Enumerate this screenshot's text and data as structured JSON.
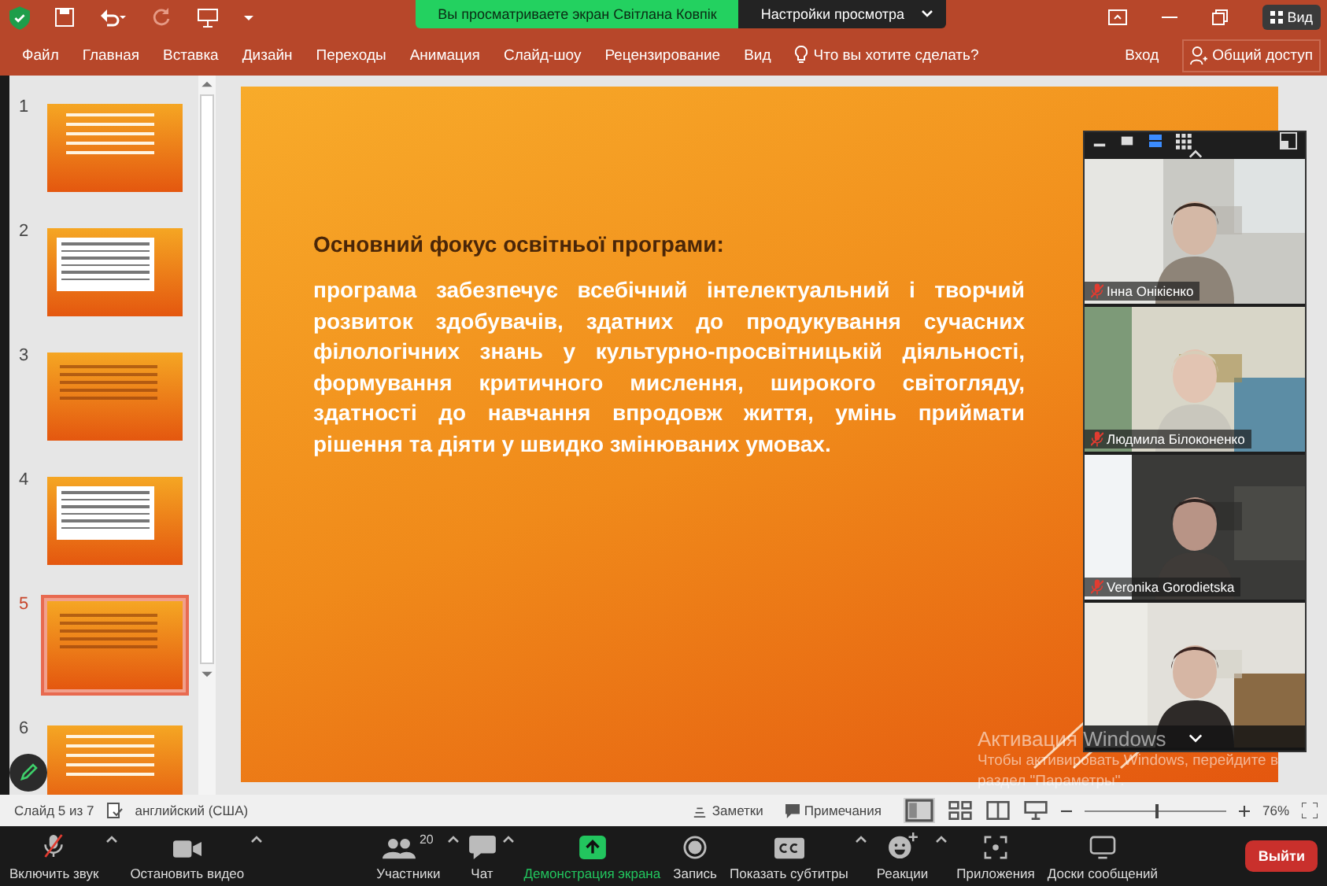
{
  "title_bar": {
    "banner": "Вы просматриваете экран Світлана Ковпік",
    "view_settings": "Настройки просмотра",
    "view_button": "Вид"
  },
  "ribbon": {
    "tabs": [
      "Файл",
      "Главная",
      "Вставка",
      "Дизайн",
      "Переходы",
      "Анимация",
      "Слайд-шоу",
      "Рецензирование",
      "Вид"
    ],
    "search": {
      "placeholder": "Что вы хотите сделать?"
    },
    "sign_in": "Вход",
    "share": "Общий доступ"
  },
  "slides_panel": {
    "slides": [
      {
        "number": "1",
        "selected": false,
        "kind": "title"
      },
      {
        "number": "2",
        "selected": false,
        "kind": "boxed"
      },
      {
        "number": "3",
        "selected": false,
        "kind": "text"
      },
      {
        "number": "4",
        "selected": false,
        "kind": "boxed"
      },
      {
        "number": "5",
        "selected": true,
        "kind": "text"
      },
      {
        "number": "6",
        "selected": false,
        "kind": "title"
      }
    ]
  },
  "slide": {
    "heading": "Основний фокус освітньої програми:",
    "body": "програма забезпечує всебічний інтелектуальний і творчий розвиток здобувачів, здатних до продукування сучасних філологічних знань у культурно-просвітницькій діяльності, формування критичного мислення, широкого світогляду, здатності до навчання впродовж життя, умінь приймати рішення та діяти у швидко змінюваних умовах."
  },
  "video_panel": {
    "participants": [
      {
        "name": "Інна Онікієнко",
        "muted": true
      },
      {
        "name": "Людмила Білоконенко",
        "muted": true
      },
      {
        "name": "Veronika Gorodietska",
        "muted": true
      },
      {
        "muted": false
      }
    ]
  },
  "status_bar": {
    "slide_counter": "Слайд 5 из 7",
    "language": "английский (США)",
    "notes": "Заметки",
    "comments": "Примечания",
    "zoom": "76%",
    "zoom_slider": {
      "level": 0.5
    }
  },
  "meeting_toolbar": {
    "buttons": [
      {
        "kind": "mic",
        "label": "Включить звук",
        "caret": true,
        "active": false,
        "muted": true
      },
      {
        "kind": "video",
        "label": "Остановить видео",
        "caret": true,
        "active": false
      },
      {
        "kind": "participants",
        "label": "Участники",
        "count": "20",
        "caret": true,
        "active": false
      },
      {
        "kind": "chat",
        "label": "Чат",
        "caret": true,
        "active": false
      },
      {
        "kind": "share",
        "label": "Демонстрация экрана",
        "caret": false,
        "active": true
      },
      {
        "kind": "record",
        "label": "Запись",
        "caret": false,
        "active": false
      },
      {
        "kind": "captions",
        "label": "Показать субтитры",
        "caret": true,
        "active": false
      },
      {
        "kind": "reactions",
        "label": "Реакции",
        "caret": true,
        "active": false
      },
      {
        "kind": "apps",
        "label": "Приложения",
        "caret": false,
        "active": false
      },
      {
        "kind": "whiteboard",
        "label": "Доски сообщений",
        "caret": false,
        "active": false
      }
    ],
    "leave": "Выйти"
  },
  "activation_notice": {
    "title": "Активация Windows",
    "text": "Чтобы активировать Windows, перейдите в раздел \"Параметры\"."
  }
}
